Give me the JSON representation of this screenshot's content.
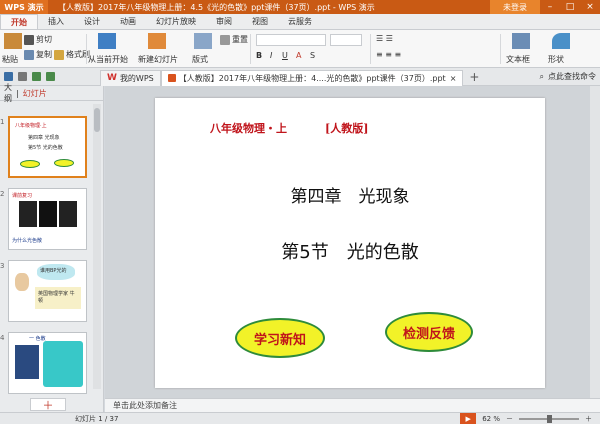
{
  "app": {
    "name": "WPS 演示",
    "title": "【人教版】2017年八年级物理上册：4.5《光的色散》ppt课件（37页）.ppt - WPS 演示",
    "login": "未登录"
  },
  "ribbon_tabs": [
    "开始",
    "插入",
    "设计",
    "动画",
    "幻灯片放映",
    "审阅",
    "视图",
    "云服务"
  ],
  "ribbon": {
    "paste": "粘贴",
    "cut": "剪切",
    "copy": "复制",
    "format_painter": "格式刷",
    "from_current": "从当前开始",
    "new_slide": "新建幻灯片",
    "layout": "版式",
    "reset": "重置",
    "textbox": "文本框",
    "shape": "形状",
    "font_name": "",
    "font_size": "0"
  },
  "quick_access": [
    "save-icon",
    "print-icon",
    "undo-icon",
    "redo-icon"
  ],
  "doc_tabs": [
    {
      "label": "我的WPS"
    },
    {
      "label": "【人教版】2017年八年级物理上册：4....光的色散》ppt课件（37页）.ppt"
    }
  ],
  "search_hint": "点此查找命令",
  "left_panel": {
    "tab_outline": "大纲",
    "tab_slides": "幻灯片"
  },
  "thumbnails": [
    {
      "num": "1",
      "line1": "八年级物理·上",
      "line2": "第四章 光现象",
      "line3": "第5节 光的色散"
    },
    {
      "num": "2",
      "line1": "课前复习",
      "line2": "为什么光色散"
    },
    {
      "num": "3",
      "line1": "谁用BP光的",
      "line2": "英国物理学家 牛顿"
    },
    {
      "num": "4",
      "line1": "一 色散"
    }
  ],
  "slide": {
    "header_left": "八年级物理・上",
    "header_right": "[人教版]",
    "chapter": "第四章　光现象",
    "section": "第5节　光的色散",
    "button_learn": "学习新知",
    "button_feedback": "检测反馈"
  },
  "notes_placeholder": "单击此处添加备注",
  "status": {
    "slide_count": "幻灯片 1 / 37",
    "zoom": "62 %"
  },
  "colors": {
    "titlebar": "#c95a14",
    "accent": "#c0141b",
    "oval_fill": "#f2f228",
    "oval_border": "#2e8b3a"
  }
}
